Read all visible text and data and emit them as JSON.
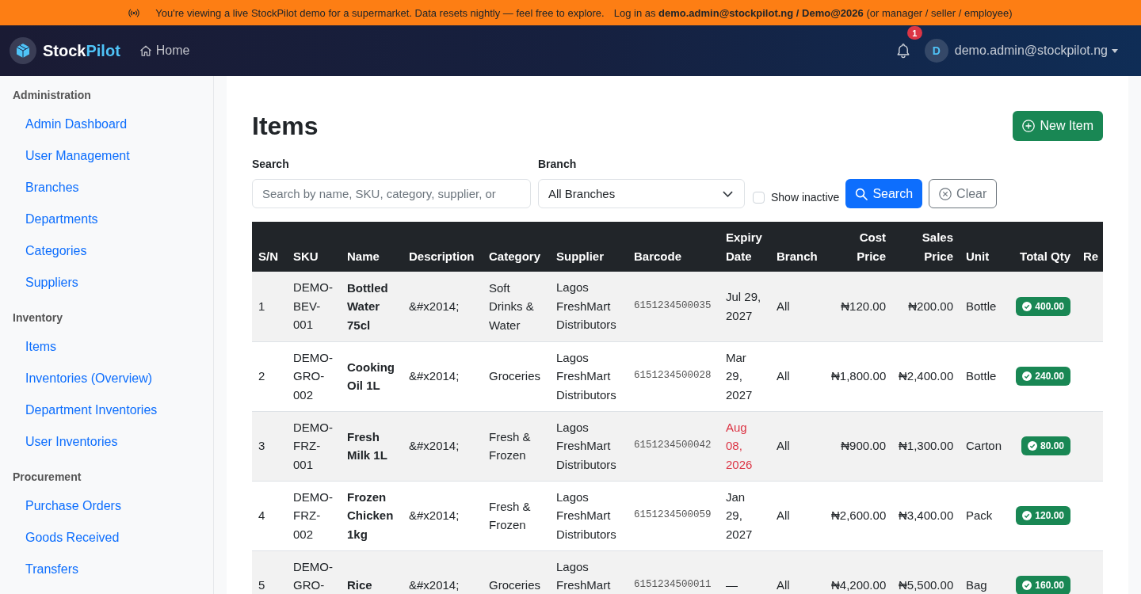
{
  "banner": {
    "message": "You're viewing a live StockPilot demo for a supermarket. Data resets nightly — feel free to explore.",
    "login_hint": "Log in as **demo.admin@stockpilot.ng / Demo@2026** (or manager / seller / employee)"
  },
  "navbar": {
    "brand_first": "Stock",
    "brand_second": "Pilot",
    "home_link": "Home",
    "notification_count": "1",
    "user_initial": "D",
    "user_email": "demo.admin@stockpilot.ng"
  },
  "sidebar": {
    "sections": [
      {
        "heading": "Administration",
        "items": [
          "Admin Dashboard",
          "User Management",
          "Branches",
          "Departments",
          "Categories",
          "Suppliers"
        ]
      },
      {
        "heading": "Inventory",
        "items": [
          "Items",
          "Inventories (Overview)",
          "Department Inventories",
          "User Inventories"
        ]
      },
      {
        "heading": "Procurement",
        "items": [
          "Purchase Orders",
          "Goods Received",
          "Transfers"
        ]
      }
    ]
  },
  "page": {
    "title": "Items",
    "new_button": "New Item"
  },
  "filters": {
    "search_label": "Search",
    "search_placeholder": "Search by name, SKU, category, supplier, or",
    "branch_label": "Branch",
    "branch_value": "All Branches",
    "show_inactive": {
      "label": "Show inactive",
      "checked": false
    },
    "search_button": "Search",
    "clear_button": "Clear"
  },
  "table": {
    "columns": [
      "S/N",
      "SKU",
      "Name",
      "Description",
      "Category",
      "Supplier",
      "Barcode",
      "Expiry Date",
      "Branch",
      "Cost Price",
      "Sales Price",
      "Unit",
      "Total Qty",
      "Re"
    ],
    "rows": [
      {
        "sn": "1",
        "sku": "DEMO-BEV-001",
        "name": "Bottled Water 75cl",
        "description": "&#x2014;",
        "category": "Soft Drinks & Water",
        "supplier": "Lagos FreshMart Distributors",
        "barcode": "6151234500035",
        "expiry": "Jul 29, 2027",
        "expiring_soon": false,
        "branch": "All",
        "cost_price": "₦120.00",
        "sales_price": "₦200.00",
        "unit": "Bottle",
        "total_qty": "400.00"
      },
      {
        "sn": "2",
        "sku": "DEMO-GRO-002",
        "name": "Cooking Oil 1L",
        "description": "&#x2014;",
        "category": "Groceries",
        "supplier": "Lagos FreshMart Distributors",
        "barcode": "6151234500028",
        "expiry": "Mar 29, 2027",
        "expiring_soon": false,
        "branch": "All",
        "cost_price": "₦1,800.00",
        "sales_price": "₦2,400.00",
        "unit": "Bottle",
        "total_qty": "240.00"
      },
      {
        "sn": "3",
        "sku": "DEMO-FRZ-001",
        "name": "Fresh Milk 1L",
        "description": "&#x2014;",
        "category": "Fresh & Frozen",
        "supplier": "Lagos FreshMart Distributors",
        "barcode": "6151234500042",
        "expiry": "Aug 08, 2026",
        "expiring_soon": true,
        "branch": "All",
        "cost_price": "₦900.00",
        "sales_price": "₦1,300.00",
        "unit": "Carton",
        "total_qty": "80.00"
      },
      {
        "sn": "4",
        "sku": "DEMO-FRZ-002",
        "name": "Frozen Chicken 1kg",
        "description": "&#x2014;",
        "category": "Fresh & Frozen",
        "supplier": "Lagos FreshMart Distributors",
        "barcode": "6151234500059",
        "expiry": "Jan 29, 2027",
        "expiring_soon": false,
        "branch": "All",
        "cost_price": "₦2,600.00",
        "sales_price": "₦3,400.00",
        "unit": "Pack",
        "total_qty": "120.00"
      },
      {
        "sn": "5",
        "sku": "DEMO-GRO-",
        "name": "Rice",
        "description": "&#x2014;",
        "category": "Groceries",
        "supplier": "Lagos FreshMart",
        "barcode": "6151234500011",
        "expiry": "—",
        "expiring_soon": false,
        "branch": "All",
        "cost_price": "₦4,200.00",
        "sales_price": "₦5,500.00",
        "unit": "Bag",
        "total_qty": "160.00"
      }
    ]
  }
}
